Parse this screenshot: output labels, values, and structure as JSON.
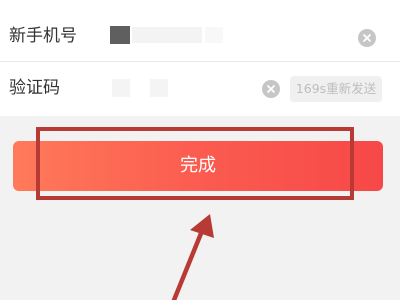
{
  "form": {
    "phone_label": "新手机号",
    "code_label": "验证码",
    "resend_label": "169s重新发送"
  },
  "submit": {
    "label": "完成"
  },
  "icons": {
    "clear": "clear-circle-icon",
    "annotation": "red-arrow-icon"
  },
  "colors": {
    "accent": "#f95a4c",
    "annotation": "#b83a34",
    "muted_text": "#bdbdbd"
  }
}
